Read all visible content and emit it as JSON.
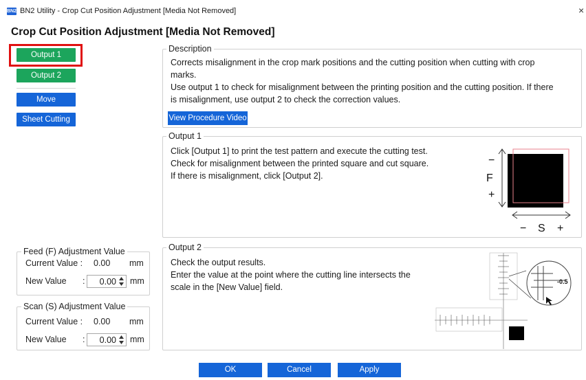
{
  "window": {
    "logo_text": "BN2",
    "title": "BN2 Utility - Crop Cut Position Adjustment [Media Not Removed]",
    "close_glyph": "×"
  },
  "page_title": "Crop Cut Position Adjustment [Media Not Removed]",
  "sidebar": {
    "output1_label": "Output 1",
    "output2_label": "Output 2",
    "move_label": "Move",
    "sheet_cutting_label": "Sheet Cutting"
  },
  "feed": {
    "title": "Feed (F) Adjustment Value",
    "current_label": "Current Value :",
    "current_value": "0.00",
    "new_label": "New Value",
    "colon": ":",
    "new_value": "0.00",
    "unit": "mm"
  },
  "scan": {
    "title": "Scan (S) Adjustment Value",
    "current_label": "Current Value :",
    "current_value": "0.00",
    "new_label": "New Value",
    "colon": ":",
    "new_value": "0.00",
    "unit": "mm"
  },
  "description": {
    "title": "Description",
    "line1": "Corrects misalignment in the crop mark positions and the cutting position when cutting with crop",
    "line2": "marks.",
    "line3": "Use output 1 to check for misalignment between the printing position and the cutting position. If there",
    "line4": "is misalignment, use output 2 to check the correction values.",
    "video_button": "View Procedure Video"
  },
  "output1": {
    "title": "Output 1",
    "line1": "Click [Output 1] to print the test pattern and execute the cutting test.",
    "line2": "Check for misalignment between the printed square and cut square.",
    "line3": "If there is misalignment, click [Output 2].",
    "diagram": {
      "minus": "−",
      "f_label": "F",
      "plus": "+",
      "s_minus": "−",
      "s_label": "S",
      "s_plus": "+"
    }
  },
  "output2": {
    "title": "Output 2",
    "line1": "Check the output results.",
    "line2": "Enter the value at the point where the cutting line intersects the",
    "line3": "scale in the [New Value] field.",
    "diagram": {
      "callout_value": "-0.5"
    }
  },
  "footer": {
    "ok_label": "OK",
    "cancel_label": "Cancel",
    "apply_label": "Apply"
  },
  "colors": {
    "green": "#1ca55c",
    "blue": "#1565d8",
    "highlight_red": "#e01010"
  }
}
